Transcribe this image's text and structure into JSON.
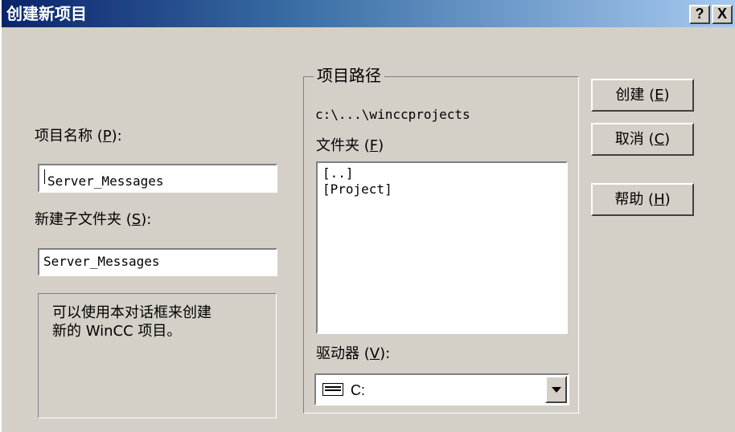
{
  "window": {
    "title": "创建新项目",
    "help_button": "?",
    "close_button": "X"
  },
  "project_name": {
    "label": "项目名称",
    "accel": "P",
    "value": "Server_Messages"
  },
  "subfolder": {
    "label": "新建子文件夹",
    "accel": "S",
    "value": "Server_Messages"
  },
  "info_text": "可以使用本对话框来创建\n新的 WinCC 项目。",
  "project_path": {
    "group_title": "项目路径",
    "path": "c:\\...\\winccprojects",
    "folder_label": "文件夹",
    "folder_accel": "F",
    "folders": [
      "[..]",
      "[Project]"
    ],
    "drive_label": "驱动器",
    "drive_accel": "V",
    "drive_value": "C:"
  },
  "buttons": {
    "create": {
      "label": "创建",
      "accel": "E"
    },
    "cancel": {
      "label": "取消",
      "accel": "C"
    },
    "help": {
      "label": "帮助",
      "accel": "H"
    }
  },
  "icons": [
    "drive-icon",
    "dropdown-arrow-icon",
    "help-icon",
    "close-icon"
  ]
}
